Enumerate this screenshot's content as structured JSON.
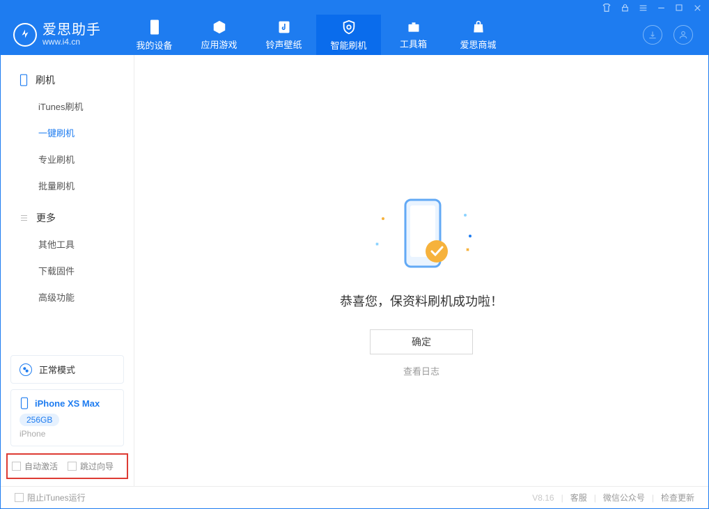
{
  "app": {
    "name_cn": "爱思助手",
    "url": "www.i4.cn"
  },
  "tabs": [
    {
      "label": "我的设备"
    },
    {
      "label": "应用游戏"
    },
    {
      "label": "铃声壁纸"
    },
    {
      "label": "智能刷机"
    },
    {
      "label": "工具箱"
    },
    {
      "label": "爱思商城"
    }
  ],
  "sidebar": {
    "group1": "刷机",
    "items1": [
      "iTunes刷机",
      "一键刷机",
      "专业刷机",
      "批量刷机"
    ],
    "group2": "更多",
    "items2": [
      "其他工具",
      "下载固件",
      "高级功能"
    ]
  },
  "mode_card": {
    "label": "正常模式"
  },
  "device": {
    "name": "iPhone XS Max",
    "storage": "256GB",
    "type": "iPhone"
  },
  "options": {
    "auto_activate": "自动激活",
    "skip_guide": "跳过向导"
  },
  "main": {
    "message": "恭喜您，保资料刷机成功啦！",
    "ok": "确定",
    "view_log": "查看日志"
  },
  "footer": {
    "block_itunes": "阻止iTunes运行",
    "version": "V8.16",
    "links": [
      "客服",
      "微信公众号",
      "检查更新"
    ]
  }
}
